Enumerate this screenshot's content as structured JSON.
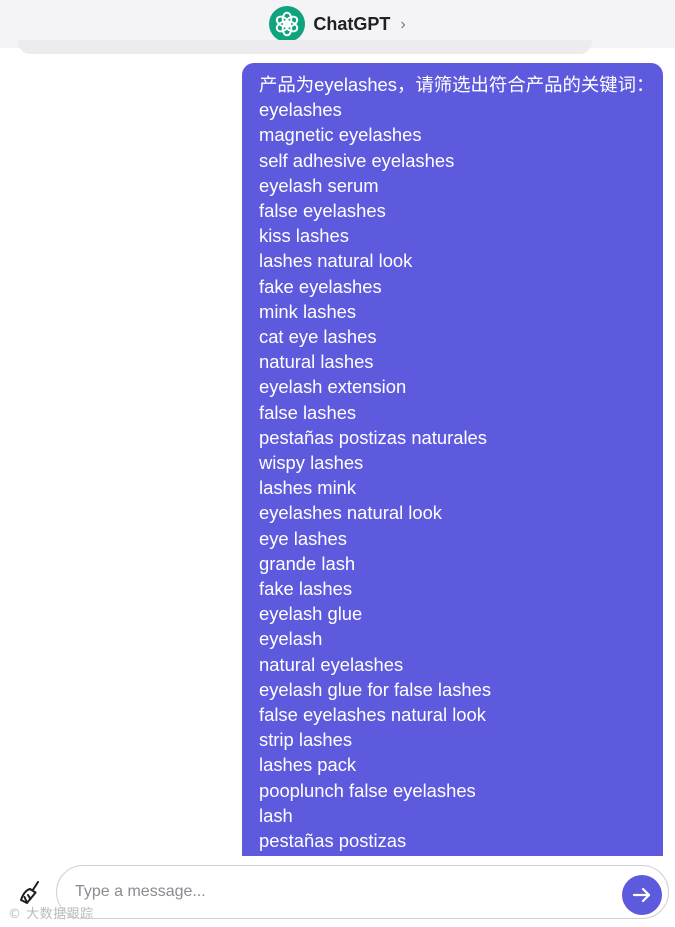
{
  "header": {
    "title": "ChatGPT",
    "chevron": "›",
    "logo_icon": "openai-logo-icon",
    "logo_color": "#10a37f"
  },
  "message": {
    "bubble_color": "#5e5ade",
    "lines": [
      "产品为eyelashes，请筛选出符合产品的关键词：",
      "eyelashes",
      "magnetic eyelashes",
      "self adhesive eyelashes",
      "eyelash serum",
      "false eyelashes",
      "kiss lashes",
      "lashes natural look",
      "fake eyelashes",
      "mink lashes",
      "cat eye lashes",
      "natural lashes",
      "eyelash extension",
      "false lashes",
      "pestañas postizas naturales",
      "wispy lashes",
      "lashes mink",
      "eyelashes natural look",
      "eye lashes",
      "grande lash",
      "fake lashes",
      "eyelash glue",
      "eyelash",
      "natural eyelashes",
      "eyelash glue for false lashes",
      "false eyelashes natural look",
      "strip lashes",
      "lashes pack",
      "pooplunch false eyelashes",
      "lash",
      "pestañas postizas"
    ]
  },
  "composer": {
    "placeholder": "Type a message...",
    "value": "",
    "clear_icon": "brush-icon",
    "send_icon": "arrow-right-icon",
    "accent": "#5e5ade"
  },
  "watermark": "© 大数据跟踪"
}
